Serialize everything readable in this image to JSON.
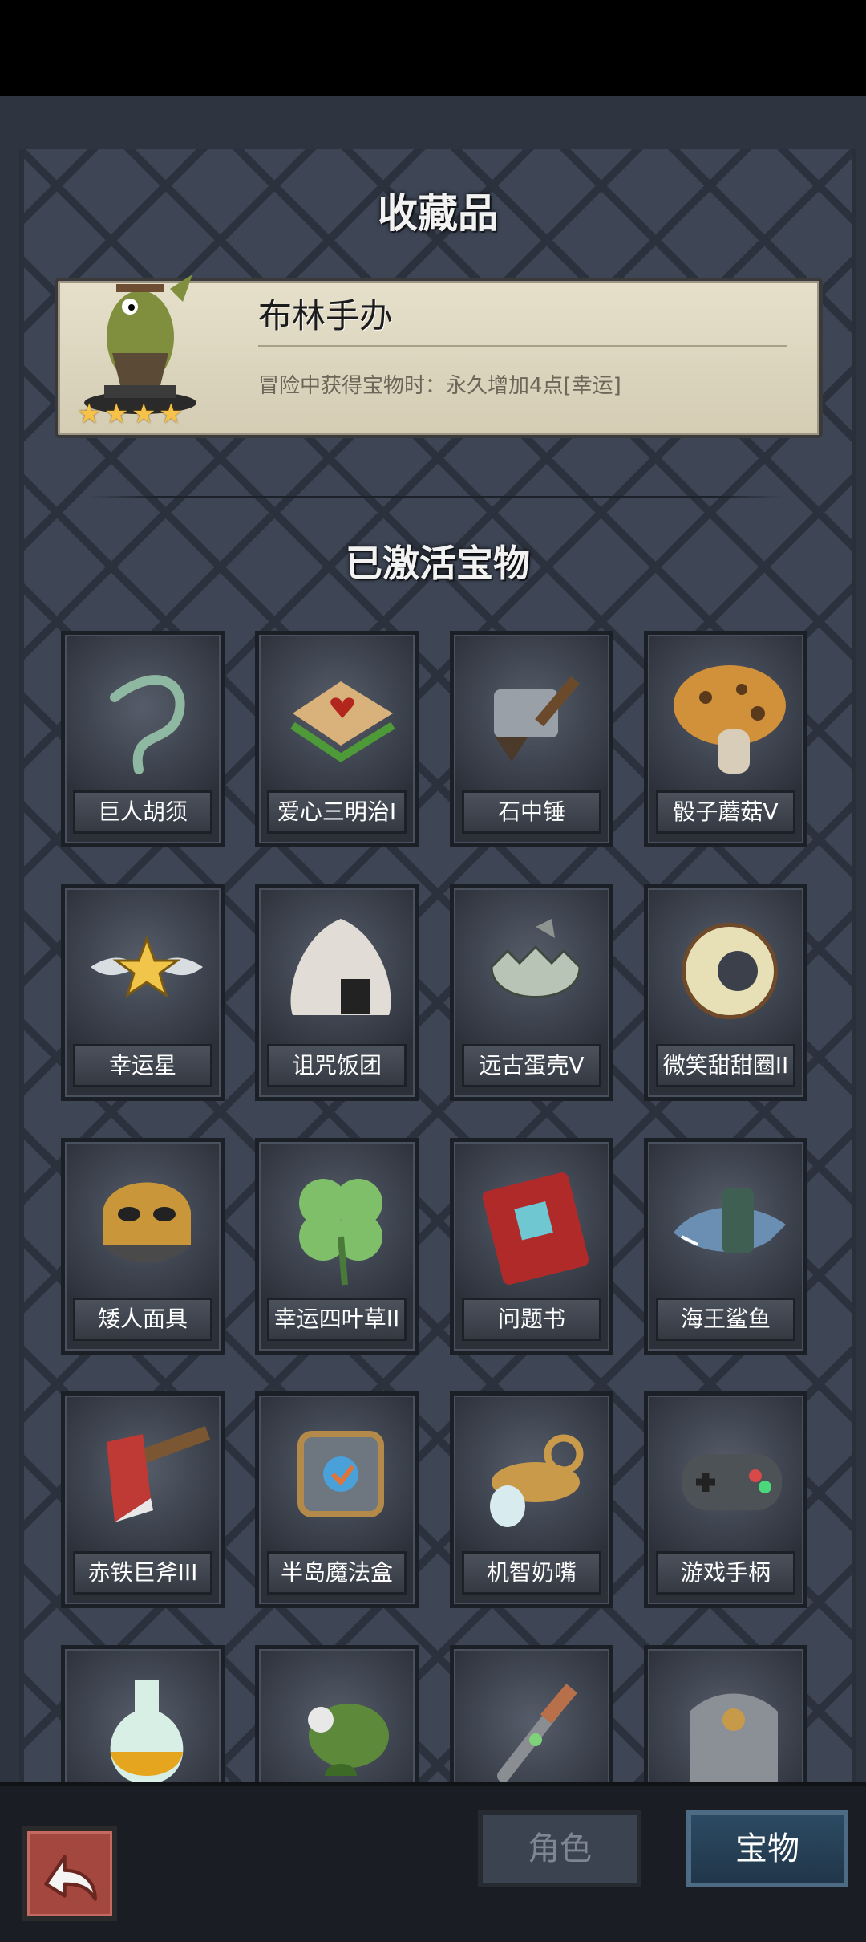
{
  "page": {
    "title": "收藏品",
    "section_title": "已激活宝物"
  },
  "featured": {
    "name": "布林手办",
    "description": "冒险中获得宝物时：永久增加4点[幸运]",
    "stars": 4
  },
  "treasures": [
    {
      "label": "巨人胡须",
      "icon": "beard-icon"
    },
    {
      "label": "爱心三明治I",
      "icon": "sandwich-icon"
    },
    {
      "label": "石中锤",
      "icon": "hammer-icon"
    },
    {
      "label": "骰子蘑菇V",
      "icon": "mushroom-icon"
    },
    {
      "label": "幸运星",
      "icon": "winged-star-icon"
    },
    {
      "label": "诅咒饭团",
      "icon": "rice-ball-icon"
    },
    {
      "label": "远古蛋壳V",
      "icon": "eggshell-icon"
    },
    {
      "label": "微笑甜甜圈II",
      "icon": "donut-icon"
    },
    {
      "label": "矮人面具",
      "icon": "mask-icon"
    },
    {
      "label": "幸运四叶草II",
      "icon": "clover-icon"
    },
    {
      "label": "问题书",
      "icon": "book-icon"
    },
    {
      "label": "海王鲨鱼",
      "icon": "shark-icon"
    },
    {
      "label": "赤铁巨斧III",
      "icon": "axe-icon"
    },
    {
      "label": "半岛魔法盒",
      "icon": "magic-cube-icon"
    },
    {
      "label": "机智奶嘴",
      "icon": "pacifier-icon"
    },
    {
      "label": "游戏手柄",
      "icon": "gamepad-icon"
    },
    {
      "label": "",
      "icon": "potion-icon"
    },
    {
      "label": "",
      "icon": "plant-icon"
    },
    {
      "label": "",
      "icon": "dagger-icon"
    },
    {
      "label": "",
      "icon": "armor-icon"
    }
  ],
  "bottom_nav": {
    "back_icon": "back-arrow-icon",
    "tab_role": "角色",
    "tab_treasure": "宝物"
  }
}
